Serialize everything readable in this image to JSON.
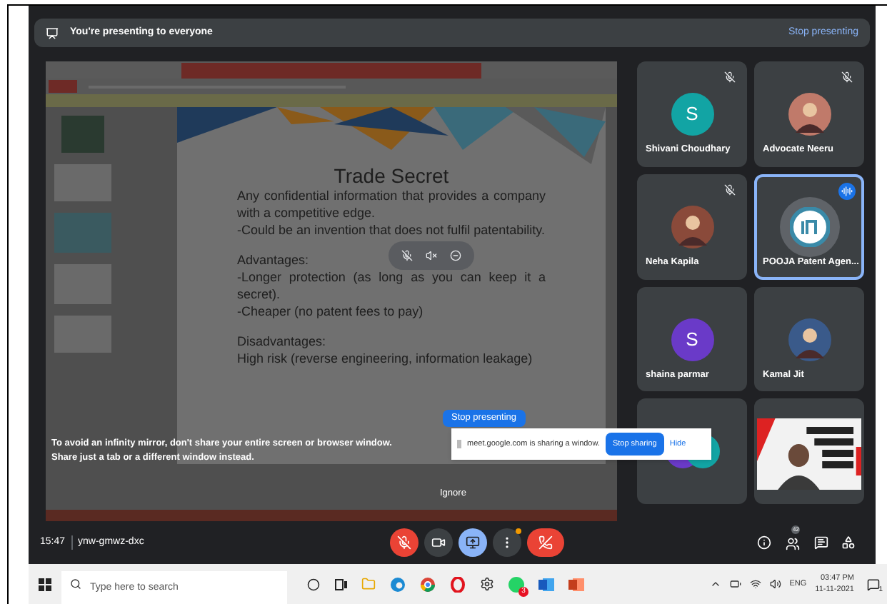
{
  "banner": {
    "title": "You're presenting to everyone",
    "action": "Stop presenting"
  },
  "slide": {
    "title": "Trade Secret",
    "lines": [
      {
        "kind": "text",
        "text": "Any confidential information that provides a company with a competitive edge."
      },
      {
        "kind": "text",
        "text": "-Could be an invention that does not fulfil patentability."
      },
      {
        "kind": "gap"
      },
      {
        "kind": "text",
        "text": "Advantages:"
      },
      {
        "kind": "text",
        "text": "-Longer protection (as long as you can keep it a secret)."
      },
      {
        "kind": "text",
        "text": "-Cheaper (no patent fees to pay)"
      },
      {
        "kind": "gap"
      },
      {
        "kind": "text",
        "text": "Disadvantages:"
      },
      {
        "kind": "text",
        "text": "High risk (reverse engineering, information leakage)"
      }
    ]
  },
  "mirror_warning": {
    "lines": [
      "To avoid an infinity mirror, don't share your entire screen or browser window.",
      "Share just a tab or a different window instead."
    ],
    "action": "Stop presenting",
    "dismiss": "Ignore"
  },
  "share_bar": {
    "message": "meet.google.com is sharing a window.",
    "stop": "Stop sharing",
    "hide": "Hide"
  },
  "tiles": [
    {
      "kind": "letter",
      "name": "Shivani Choudhary",
      "letter": "S",
      "color": "#12a4a4",
      "muted": true,
      "speaking": false
    },
    {
      "name": "Advocate Neeru",
      "color": "#c07a6a",
      "muted": true,
      "speaking": false
    },
    {
      "name": "Neha Kapila",
      "color": "#8a4a3a",
      "muted": true,
      "speaking": false
    },
    {
      "kind": "logo",
      "name": "POOJA Patent Agen...",
      "color": "#3a8aa8",
      "muted": false,
      "speaking": true
    },
    {
      "kind": "letter",
      "name": "shaina parmar",
      "letter": "S",
      "color": "#6a3ac8",
      "muted": false,
      "speaking": false
    },
    {
      "name": "Kamal Jit",
      "color": "#3a5a8a",
      "muted": false,
      "speaking": false
    },
    {
      "kind": "group",
      "color": "#12a4a4",
      "muted": false,
      "speaking": false
    },
    {
      "kind": "video",
      "muted": false,
      "speaking": false
    }
  ],
  "meeting": {
    "time": "15:47",
    "code": "ynw-gmwz-dxc",
    "people_count": "42"
  },
  "controls": [
    {
      "kind": "mic",
      "on": false
    },
    {
      "kind": "camera",
      "on": true
    },
    {
      "kind": "present",
      "on": true
    },
    {
      "kind": "more",
      "on": true
    },
    {
      "kind": "leave",
      "on": true
    }
  ],
  "taskbar": {
    "search": {
      "placeholder": "Type here to search"
    },
    "whatsapp_badge": "3",
    "language": "ENG",
    "time": "03:47 PM",
    "date": "11-11-2021",
    "notifications": "1"
  }
}
